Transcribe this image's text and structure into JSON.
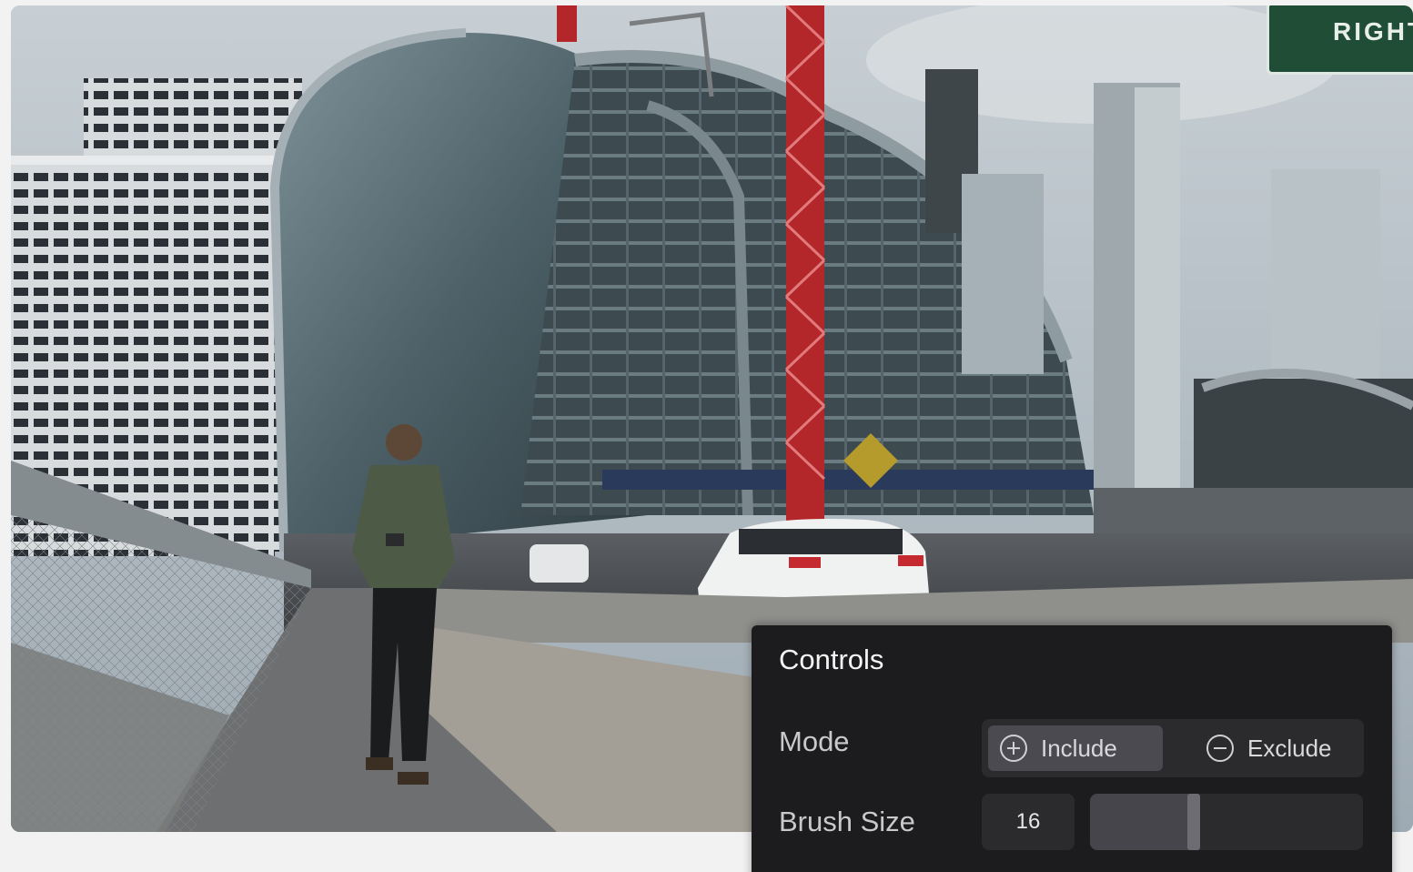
{
  "scene": {
    "sign_text": "RIGHT"
  },
  "controls": {
    "title": "Controls",
    "mode": {
      "label": "Mode",
      "options": [
        "Include",
        "Exclude"
      ],
      "selected": "Include"
    },
    "brush": {
      "label": "Brush Size",
      "value": "16",
      "slider_fraction": 0.38
    }
  },
  "colors": {
    "panel_bg": "#1c1c1e",
    "segment_selected": "#4a4a50",
    "page_bg": "#f2f2f2"
  },
  "icons": {
    "include": "plus-circle-icon",
    "exclude": "minus-circle-icon"
  }
}
